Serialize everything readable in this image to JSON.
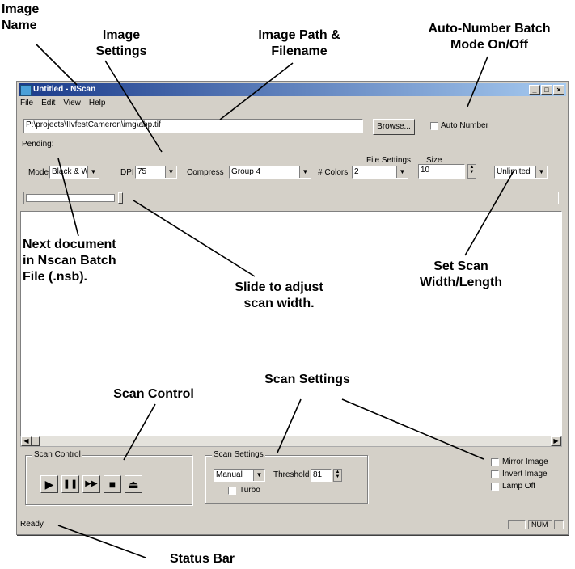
{
  "callouts": {
    "image_name": "Image\nName",
    "image_settings": "Image\nSettings",
    "image_path": "Image Path &\nFilename",
    "auto_number": "Auto-Number Batch\nMode On/Off",
    "next_document": "Next document\nin Nscan Batch\nFile (.nsb).",
    "slide": "Slide to adjust\nscan width.",
    "set_scan": "Set Scan\nWidth/Length",
    "scan_settings": "Scan Settings",
    "scan_control": "Scan Control",
    "status_bar": "Status Bar"
  },
  "window": {
    "title": "Untitled - NScan",
    "buttons": [
      "_",
      "□",
      "×"
    ],
    "menu": [
      "File",
      "Edit",
      "View",
      "Help"
    ]
  },
  "path_row": {
    "path_value": "P:\\projects\\IIvfestCameron\\img\\abp.tif",
    "browse_label": "Browse...",
    "auto_number_label": "Auto Number"
  },
  "pending_label": "Pending:",
  "settings_row": {
    "mode_label": "Mode",
    "mode_value": "Black & White",
    "dpi_label": "DPI",
    "dpi_value": "75",
    "compress_label": "Compress",
    "compress_value": "Group 4",
    "colors_label": "# Colors",
    "colors_value": "2",
    "file_settings_label": "File Settings",
    "size_label": "Size",
    "size_value": "10",
    "unlimited_value": "Unlimited"
  },
  "scan_control": {
    "group_title": "Scan Control",
    "buttons": [
      "play",
      "pause",
      "fast-forward",
      "stop",
      "eject"
    ],
    "glyphs": [
      "▶",
      "❚❚",
      "▶▶",
      "■",
      "⏏"
    ]
  },
  "scan_settings": {
    "group_title": "Scan Settings",
    "mode_value": "Manual",
    "threshold_label": "Threshold",
    "threshold_value": "81",
    "turbo_label": "Turbo"
  },
  "options": {
    "mirror": "Mirror Image",
    "invert": "Invert Image",
    "lamp": "Lamp Off"
  },
  "status": {
    "text": "Ready",
    "num": "NUM"
  }
}
